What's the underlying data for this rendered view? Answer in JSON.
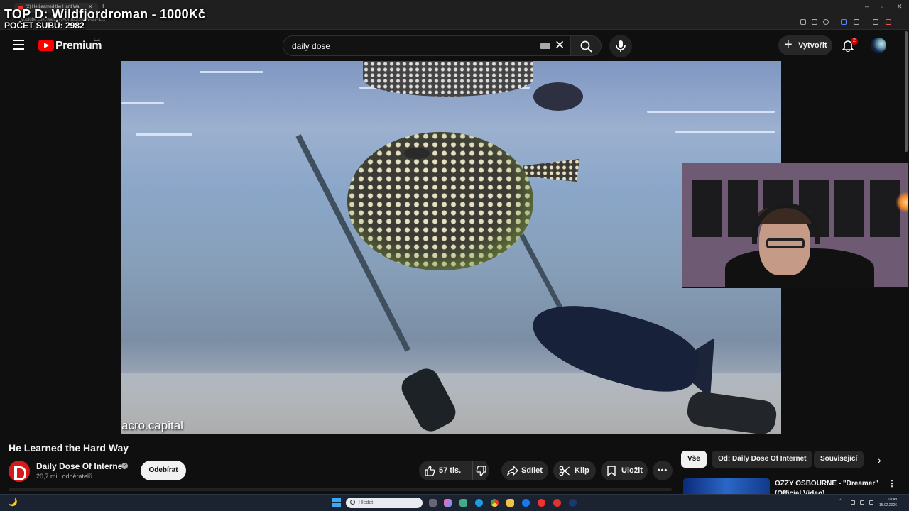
{
  "browser": {
    "tab_title": "(2) He Learned the Hard Wa",
    "url": "youtube.com/watch?v=UrpBolSobW4&t=11s"
  },
  "stream_overlay": {
    "top_donor": "TOP D: Wildfjordroman - 1000Kč",
    "subs_count": "POČET SUBŮ: 2982"
  },
  "header": {
    "logo_text": "Premium",
    "logo_country": "CZ",
    "search_value": "daily dose",
    "create_label": "Vytvořit",
    "notifications_count": "2"
  },
  "video": {
    "watermark": "acro.capital",
    "title": "He Learned the Hard Way",
    "channel": "Daily Dose Of Internet",
    "subscribers": "20,7 mil. odběratelů",
    "subscribe_label": "Odebírat",
    "likes": "57 tis.",
    "share_label": "Sdílet",
    "clip_label": "Klip",
    "save_label": "Uložit",
    "more_label": "•••"
  },
  "sidebar": {
    "chips": [
      "Vše",
      "Od: Daily Dose Of Internet",
      "Související"
    ],
    "recommendation_title": "OZZY OSBOURNE - \"Dreamer\" (Official Video)"
  },
  "taskbar": {
    "search_placeholder": "Hledat",
    "time": "18:49",
    "date": "15.02.2026"
  },
  "colors": {
    "youtube_red": "#ff0000",
    "background": "#0f0f0f",
    "chip_selected": "#f1f1f1"
  }
}
